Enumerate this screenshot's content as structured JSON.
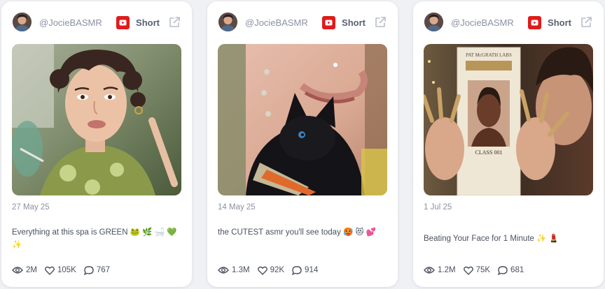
{
  "cards": [
    {
      "channel": "@JocieBASMR",
      "platform_label": "Short",
      "date": "27 May 25",
      "title": "Everything at this spa is GREEN 🐸 🌿 🛁 💚 ✨",
      "views": "2M",
      "likes": "105K",
      "comments": "767"
    },
    {
      "channel": "@JocieBASMR",
      "platform_label": "Short",
      "date": "14 May 25",
      "title": "the CUTEST asmr you'll see today 🥵 😻 💕",
      "views": "1.3M",
      "likes": "92K",
      "comments": "914"
    },
    {
      "channel": "@JocieBASMR",
      "platform_label": "Short",
      "date": "1 Jul 25",
      "title": "Beating Your Face for 1 Minute ✨ 💄",
      "views": "1.2M",
      "likes": "75K",
      "comments": "681"
    }
  ],
  "thumbnail_texts": {
    "card3_brand": "PAT McGRATH LABS",
    "card3_product": "CLASS 001"
  },
  "colors": {
    "youtube_red": "#e01b1b",
    "muted_text": "#8a91a3",
    "body_text": "#4a5060"
  }
}
